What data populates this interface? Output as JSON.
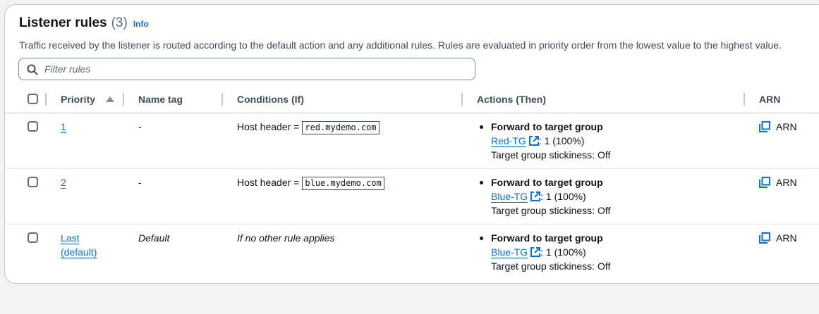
{
  "header": {
    "title": "Listener rules",
    "count": "(3)",
    "info_label": "Info",
    "description": "Traffic received by the listener is routed according to the default action and any additional rules. Rules are evaluated in priority order from the lowest value to the highest value."
  },
  "filter": {
    "placeholder": "Filter rules",
    "value": ""
  },
  "columns": {
    "priority": "Priority",
    "name_tag": "Name tag",
    "conditions": "Conditions (If)",
    "actions": "Actions (Then)",
    "arn": "ARN"
  },
  "rows": [
    {
      "priority": "1",
      "name_tag": "-",
      "condition_label": "Host header =",
      "condition_value": "red.mydemo.com",
      "action_title": "Forward to target group",
      "target_group": "Red-TG",
      "weight": ": 1 (100%)",
      "stickiness": "Target group stickiness: Off",
      "arn_label": "ARN"
    },
    {
      "priority": "2",
      "name_tag": "-",
      "condition_label": "Host header =",
      "condition_value": "blue.mydemo.com",
      "action_title": "Forward to target group",
      "target_group": "Blue-TG",
      "weight": ": 1 (100%)",
      "stickiness": "Target group stickiness: Off",
      "arn_label": "ARN"
    },
    {
      "priority_line1": "Last",
      "priority_line2": "(default)",
      "name_tag": "Default",
      "condition_text": "If no other rule applies",
      "action_title": "Forward to target group",
      "target_group": "Blue-TG",
      "weight": ": 1 (100%)",
      "stickiness": "Target group stickiness: Off",
      "arn_label": "ARN"
    }
  ],
  "icons": {
    "search": "search-icon",
    "sort": "sort-ascending-icon",
    "external_link": "external-link-icon",
    "copy": "copy-icon"
  },
  "colors": {
    "link": "#0972d3",
    "text": "#0f141a",
    "border": "#c6c6cd"
  }
}
